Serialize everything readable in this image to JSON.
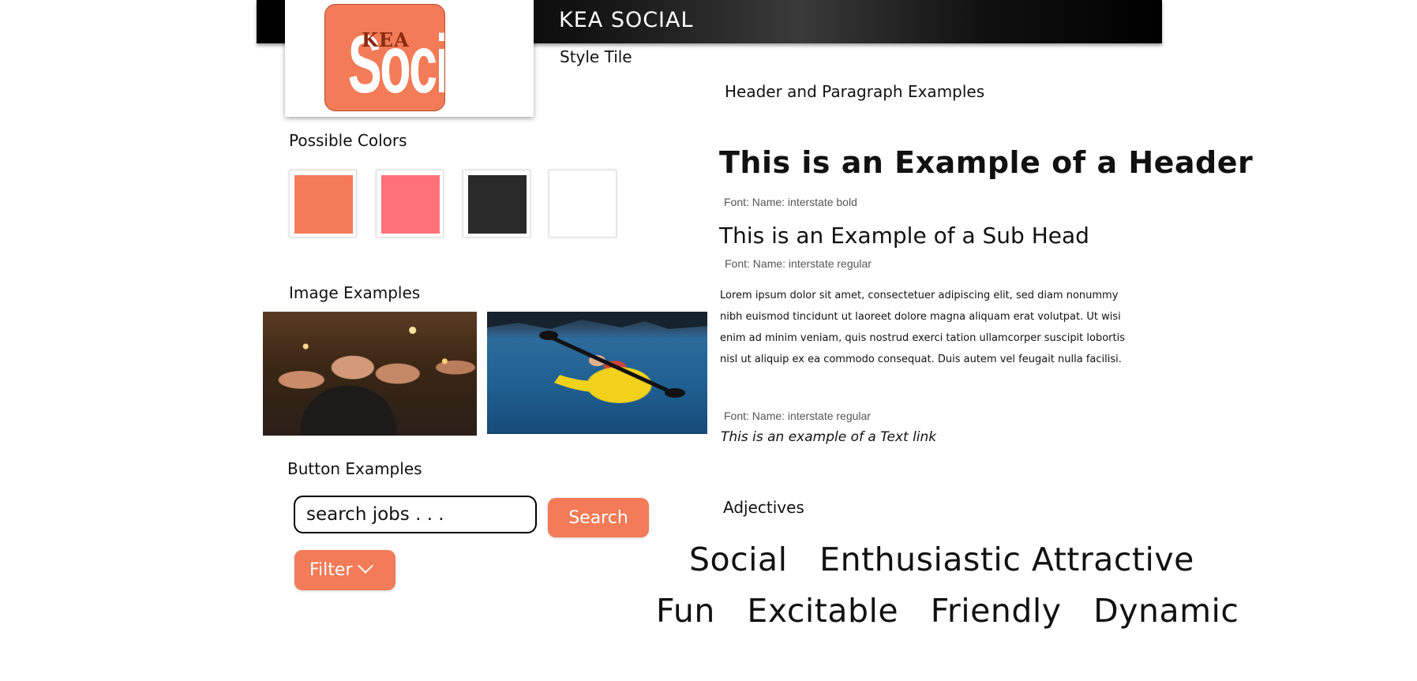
{
  "header": {
    "brand": "KEA SOCIAL",
    "subtitle": "Style Tile"
  },
  "logo": {
    "small_text": "KEA",
    "big_text": "Social",
    "background": "#f47b57"
  },
  "colors": {
    "title": "Possible Colors",
    "swatches": [
      "#f47b57",
      "#ff7179",
      "#2a2a2a",
      "#ffffff"
    ]
  },
  "images": {
    "title": "Image Examples"
  },
  "buttons": {
    "title": "Button Examples",
    "search_placeholder": "search jobs . . .",
    "search_label": "Search",
    "filter_label": "Filter",
    "accent": "#f47b57"
  },
  "typography": {
    "title": "Header and Paragraph Examples",
    "header_example": "This is an Example of a Header",
    "header_font": "Font: Name: interstate bold",
    "subhead_example": "This is an Example of a Sub Head",
    "subhead_font": "Font: Name: interstate regular",
    "paragraph": "Lorem ipsum dolor sit amet, consectetuer adipiscing elit, sed diam nonummy nibh euismod tincidunt ut laoreet dolore magna aliquam erat volutpat. Ut wisi enim ad minim veniam, quis nostrud exerci tation ullamcorper suscipit lobortis nisl ut aliquip ex ea commodo consequat. Duis autem vel feugait nulla facilisi.",
    "paragraph_font": "Font: Name: interstate regular",
    "link_example": "This is an example of a Text link"
  },
  "adjectives": {
    "title": "Adjectives",
    "row1": [
      "Social",
      "Enthusiastic",
      "Attractive"
    ],
    "row2": [
      "Fun",
      "Excitable",
      "Friendly",
      "Dynamic"
    ]
  }
}
